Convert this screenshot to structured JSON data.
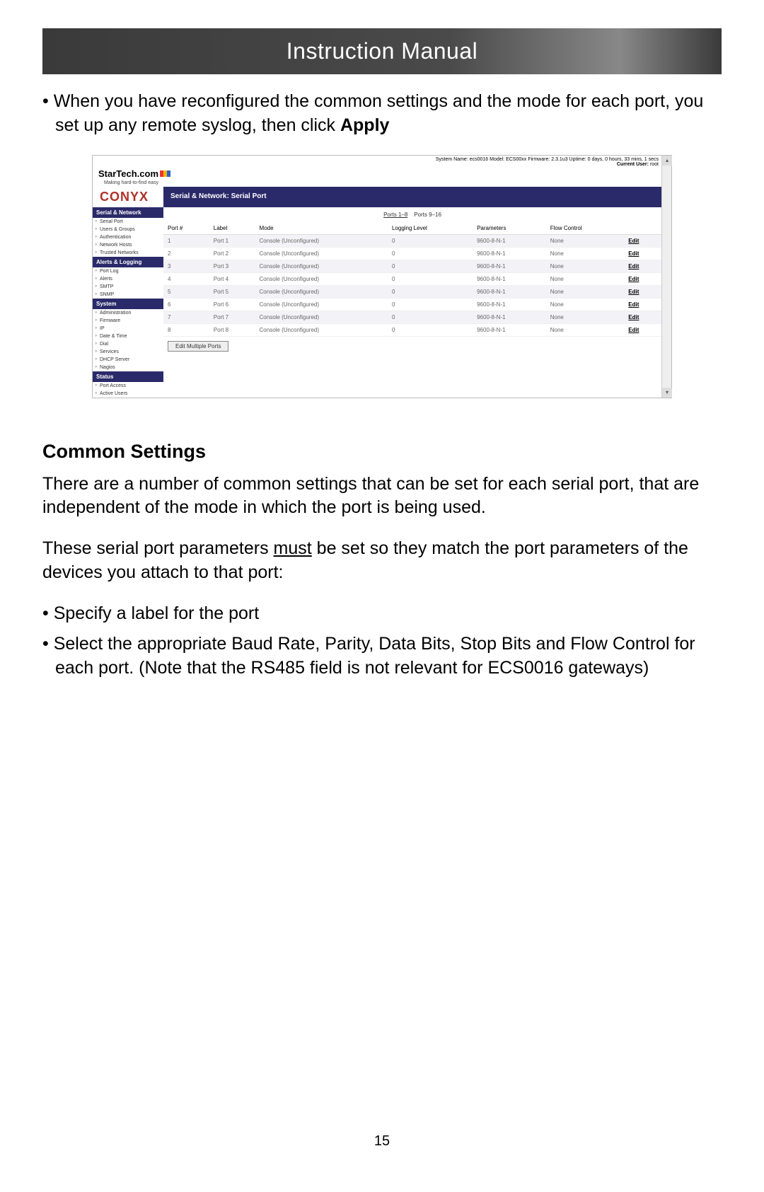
{
  "header": {
    "title": "Instruction Manual"
  },
  "intro_bullet": {
    "prefix": "When you have reconfigured the common settings and the mode for each port, you set up any remote syslog, then click ",
    "bold": "Apply"
  },
  "screenshot": {
    "status_line": "System Name: ecs0016  Model: ECS00xx  Firmware: 2.3.1u3  Uptime: 0 days, 0 hours, 33 mins, 1 secs",
    "current_user_label": "Current User:",
    "current_user": "root",
    "brand": "StarTech.com",
    "brand_tagline": "Making hard-to-find easy",
    "product": "CONYX",
    "breadcrumb": "Serial & Network: Serial Port",
    "pager": {
      "left": "Ports 1–8",
      "right": "Ports 9–16"
    },
    "sidebar": {
      "groups": [
        {
          "title": "Serial & Network",
          "items": [
            "Serial Port",
            "Users & Groups",
            "Authentication",
            "Network Hosts",
            "Trusted Networks"
          ]
        },
        {
          "title": "Alerts & Logging",
          "items": [
            "Port Log",
            "Alerts",
            "SMTP",
            "SNMP"
          ]
        },
        {
          "title": "System",
          "items": [
            "Administration",
            "Firmware",
            "IP",
            "Date & Time",
            "Dial",
            "Services",
            "DHCP Server",
            "Nagios"
          ]
        },
        {
          "title": "Status",
          "items": [
            "Port Access",
            "Active Users"
          ]
        }
      ]
    },
    "table": {
      "columns": [
        "Port #",
        "Label",
        "Mode",
        "Logging Level",
        "Parameters",
        "Flow Control",
        ""
      ],
      "rows": [
        {
          "n": "1",
          "label": "Port 1",
          "mode": "Console (Unconfigured)",
          "log": "0",
          "params": "9600-8-N-1",
          "flow": "None",
          "action": "Edit"
        },
        {
          "n": "2",
          "label": "Port 2",
          "mode": "Console (Unconfigured)",
          "log": "0",
          "params": "9600-8-N-1",
          "flow": "None",
          "action": "Edit"
        },
        {
          "n": "3",
          "label": "Port 3",
          "mode": "Console (Unconfigured)",
          "log": "0",
          "params": "9600-8-N-1",
          "flow": "None",
          "action": "Edit"
        },
        {
          "n": "4",
          "label": "Port 4",
          "mode": "Console (Unconfigured)",
          "log": "0",
          "params": "9600-8-N-1",
          "flow": "None",
          "action": "Edit"
        },
        {
          "n": "5",
          "label": "Port 5",
          "mode": "Console (Unconfigured)",
          "log": "0",
          "params": "9600-8-N-1",
          "flow": "None",
          "action": "Edit"
        },
        {
          "n": "6",
          "label": "Port 6",
          "mode": "Console (Unconfigured)",
          "log": "0",
          "params": "9600-8-N-1",
          "flow": "None",
          "action": "Edit"
        },
        {
          "n": "7",
          "label": "Port 7",
          "mode": "Console (Unconfigured)",
          "log": "0",
          "params": "9600-8-N-1",
          "flow": "None",
          "action": "Edit"
        },
        {
          "n": "8",
          "label": "Port 8",
          "mode": "Console (Unconfigured)",
          "log": "0",
          "params": "9600-8-N-1",
          "flow": "None",
          "action": "Edit"
        }
      ]
    },
    "multi_button": "Edit Multiple Ports"
  },
  "section": {
    "heading": "Common Settings",
    "p1": "There are a number of common settings that can be set for each serial port, that are independent of the mode in which the port is being used.",
    "p2_prefix": "These serial port parameters ",
    "p2_underline": "must",
    "p2_suffix": " be set so they match the port parameters of the devices you attach to that port:",
    "bullets": [
      "Specify a label for the port",
      "Select the appropriate Baud Rate, Parity, Data Bits, Stop Bits and Flow Control for each port. (Note that the RS485 field is not relevant for ECS0016 gateways)"
    ]
  },
  "page_number": "15"
}
